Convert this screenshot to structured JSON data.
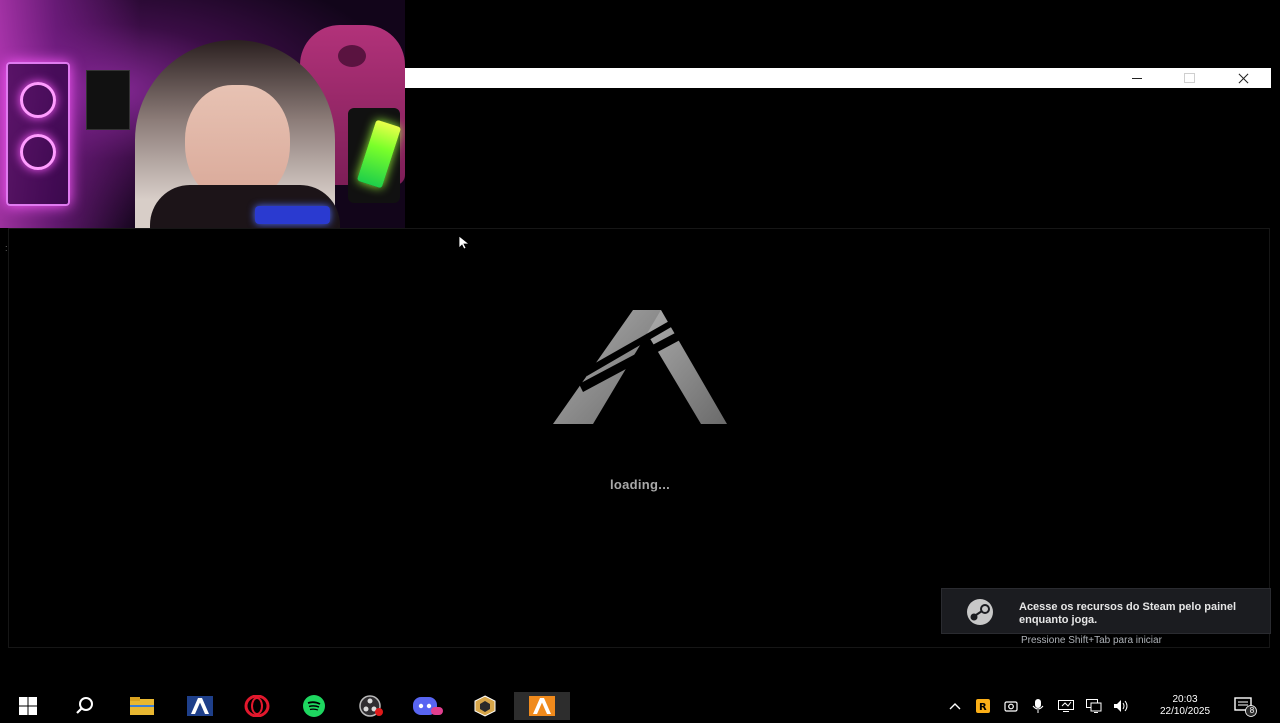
{
  "window": {
    "minimize_label": "—",
    "maximize_label": "☐",
    "close_label": "✕"
  },
  "launcher": {
    "status_text": "loading..."
  },
  "steam_toast": {
    "message": "Acesse os recursos do Steam pelo painel enquanto joga.",
    "hint": "Pressione Shift+Tab para iniciar"
  },
  "taskbar": {
    "apps": [
      "start",
      "search",
      "file-explorer",
      "launcher",
      "opera-gx",
      "spotify",
      "obs",
      "discord",
      "overwolf",
      "launcher-active"
    ],
    "clock_time": "20:03",
    "clock_date": "22/10/2025",
    "notification_count": "8"
  },
  "colors": {
    "taskbar_bg": "#000000",
    "toast_bg": "#1b1c20",
    "loading_text": "#a9a9a9",
    "active_app_bg": "#2d2d2d"
  }
}
